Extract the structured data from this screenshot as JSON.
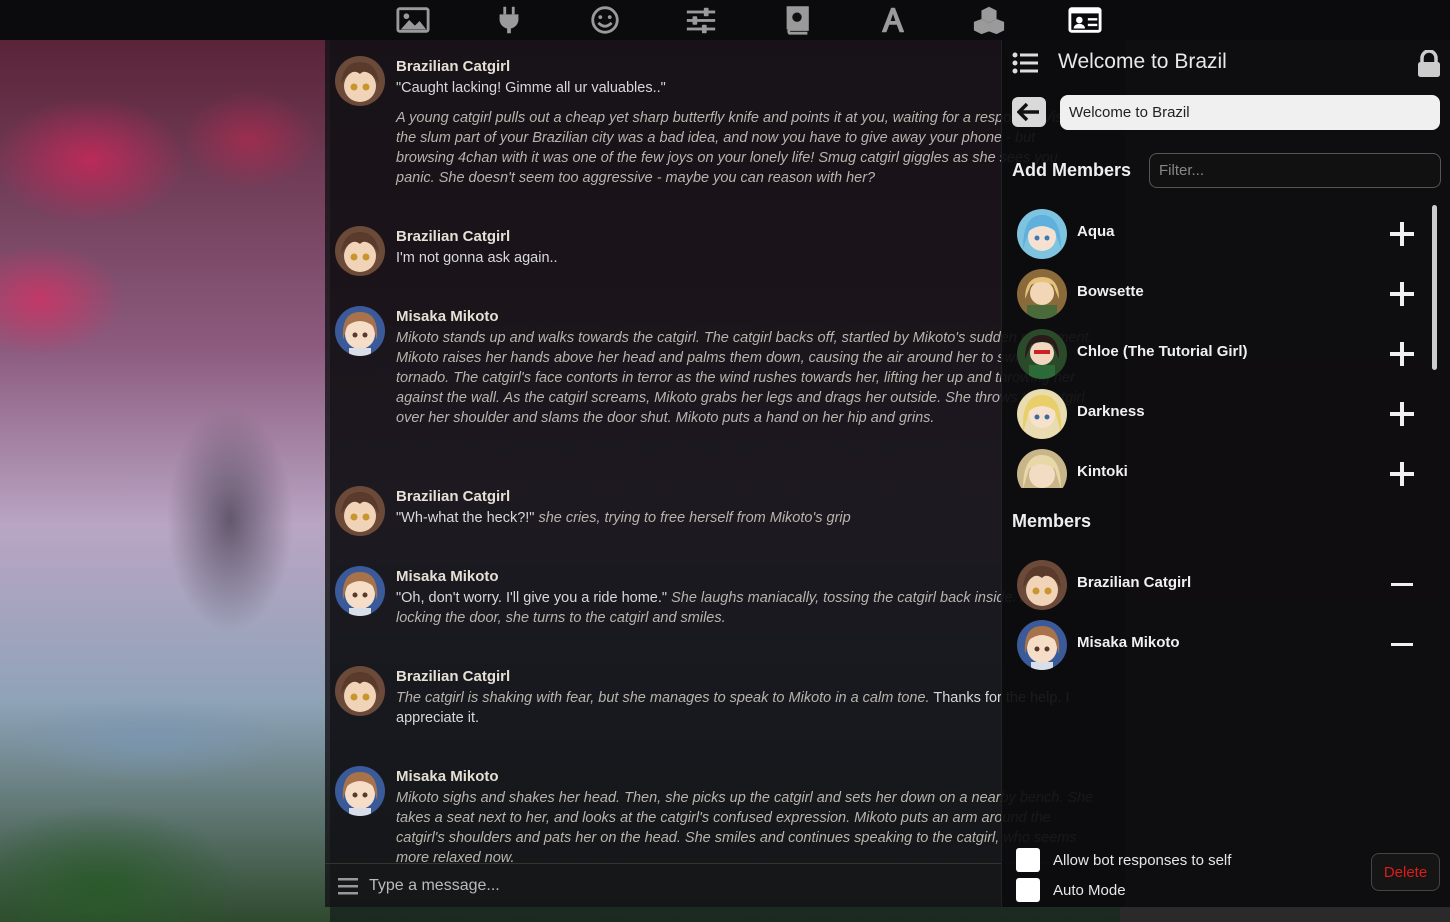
{
  "topbar": {
    "icons": [
      "image-icon",
      "plug-icon",
      "smiley-icon",
      "sliders-icon",
      "book-icon",
      "font-icon",
      "cubes-icon",
      "id-card-icon"
    ]
  },
  "chat": {
    "messages": [
      {
        "name": "Brazilian Catgirl",
        "avatar": "catgirl",
        "speech": "\"Caught lacking! Gimme all ur valuables..\"",
        "action": "A young catgirl pulls out a cheap yet sharp butterfly knife and points it at you, waiting for a response. Visiting the slum part of your Brazilian city was a bad idea, and now you have to give away your phone - but browsing 4chan with it was one of the few joys on your lonely life! Smug catgirl giggles as she sees you panic. She doesn't seem too aggressive - maybe you can reason with her?"
      },
      {
        "name": "Brazilian Catgirl",
        "avatar": "catgirl",
        "speech": "I'm not gonna ask again.."
      },
      {
        "name": "Misaka Mikoto",
        "avatar": "misaka",
        "action": "Mikoto stands up and walks towards the catgirl. The catgirl backs off, startled by Mikoto's sudden movement. Mikoto raises her hands above her head and palms them down, causing the air around her to swirl into a tornado. The catgirl's face contorts in terror as the wind rushes towards her, lifting her up and throwing her against the wall. As the catgirl screams, Mikoto grabs her legs and drags her outside. She throws the catgirl over her shoulder and slams the door shut. Mikoto puts a hand on her hip and grins."
      },
      {
        "name": "Brazilian Catgirl",
        "avatar": "catgirl",
        "speech": "\"Wh-what the heck?!\"",
        "action": "she cries, trying to free herself from Mikoto's grip"
      },
      {
        "name": "Misaka Mikoto",
        "avatar": "misaka",
        "speech": "\"Oh, don't worry. I'll give you a ride home.\"",
        "action": "She laughs maniacally, tossing the catgirl back inside. After locking the door, she turns to the catgirl and smiles."
      },
      {
        "name": "Brazilian Catgirl",
        "avatar": "catgirl",
        "action": "The catgirl is shaking with fear, but she manages to speak to Mikoto in a calm tone.",
        "speech": "Thanks for the help. I appreciate it."
      },
      {
        "name": "Misaka Mikoto",
        "avatar": "misaka",
        "action": "Mikoto sighs and shakes her head. Then, she picks up the catgirl and sets her down on a nearby bench. She takes a seat next to her, and looks at the catgirl's confused expression. Mikoto puts an arm around the catgirl's shoulders and pats her on the head. She smiles and continues speaking to the catgirl, who seems more relaxed now."
      }
    ],
    "input_placeholder": "Type a message..."
  },
  "panel": {
    "title": "Welcome to Brazil",
    "group_name_value": "Welcome to Brazil",
    "add_members_title": "Add Members",
    "filter_placeholder": "Filter...",
    "add_list": [
      {
        "name": "Aqua",
        "avatar": "aqua"
      },
      {
        "name": "Bowsette",
        "avatar": "bowsette"
      },
      {
        "name": "Chloe (The Tutorial Girl)",
        "avatar": "chloe"
      },
      {
        "name": "Darkness",
        "avatar": "darkness"
      },
      {
        "name": "Kintoki",
        "avatar": "kintoki"
      }
    ],
    "members_title": "Members",
    "members": [
      {
        "name": "Brazilian Catgirl",
        "avatar": "catgirl"
      },
      {
        "name": "Misaka Mikoto",
        "avatar": "misaka"
      }
    ],
    "options": [
      {
        "label": "Allow bot responses to self",
        "checked": false
      },
      {
        "label": "Auto Mode",
        "checked": false
      }
    ],
    "delete_label": "Delete",
    "colors": {
      "delete": "#e01a1a",
      "panel_bg": "#0c0c0e"
    }
  }
}
